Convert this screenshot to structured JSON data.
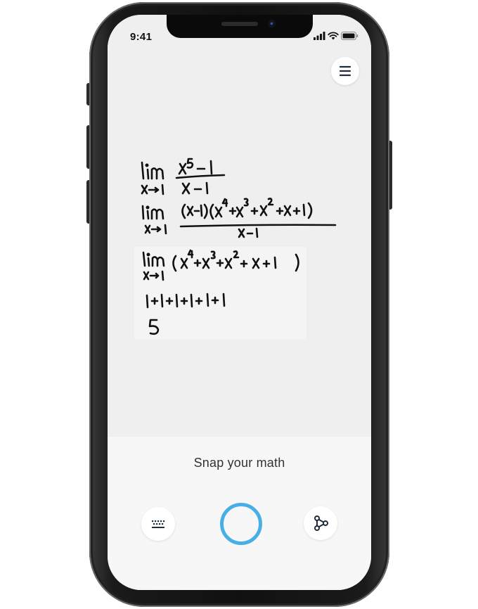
{
  "status_bar": {
    "time": "9:41",
    "icons": [
      "cellular-signal-icon",
      "wifi-icon",
      "battery-icon"
    ]
  },
  "camera_view": {
    "description_icons": [
      "menu-icon"
    ]
  },
  "bottom_panel": {
    "prompt": "Snap your math",
    "buttons": {
      "keyboard": "keyboard-icon",
      "shutter": "camera-shutter-button",
      "graph": "graph-share-icon"
    }
  },
  "colors": {
    "accent": "#4aaee6",
    "ink": "#111111",
    "panel": "#f7f7f7",
    "camera_bg": "#efefef"
  },
  "handwriting": {
    "line1": [
      "lim",
      "x→1",
      "x⁵ − 1",
      "x − 1"
    ],
    "line2": [
      "lim",
      "x→1",
      "(x−1)(x⁴+x³+x²+x+1)",
      "x − 1"
    ],
    "line3": [
      "lim",
      "x→1",
      "(x⁴+x³+x²+x+1)"
    ],
    "line4": "1+1+1+1+1",
    "line5": "5"
  }
}
